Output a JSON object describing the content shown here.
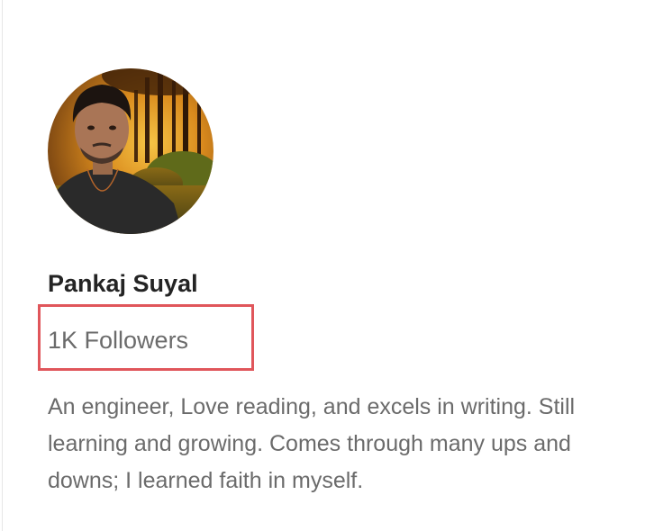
{
  "profile": {
    "name": "Pankaj Suyal",
    "followers": "1K Followers",
    "bio": "An engineer, Love reading, and excels in writing. Still learning and growing. Comes through many ups and downs; I learned faith in myself.",
    "avatar_icon": "avatar-photo",
    "highlight_color": "#e0565b"
  }
}
